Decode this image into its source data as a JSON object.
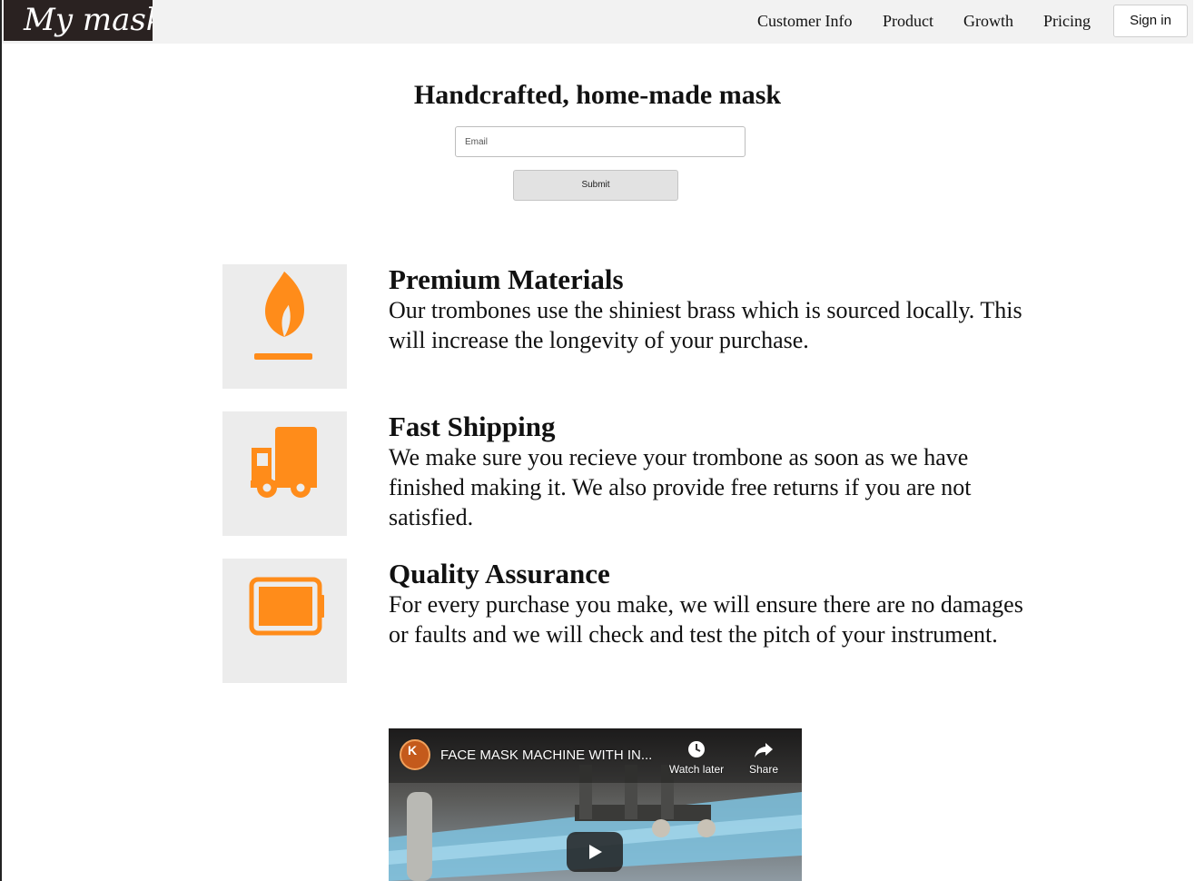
{
  "brand": {
    "logo_text": "My mask"
  },
  "nav": {
    "items": [
      {
        "label": "Customer Info"
      },
      {
        "label": "Product"
      },
      {
        "label": "Growth"
      },
      {
        "label": "Pricing"
      }
    ],
    "signin_label": "Sign in"
  },
  "hero": {
    "title": "Handcrafted, home-made mask",
    "email_placeholder": "Email",
    "submit_label": "Submit"
  },
  "features": [
    {
      "icon": "flame-icon",
      "title": "Premium Materials",
      "description": "Our trombones use the shiniest brass which is sourced locally. This will increase the longevity of your purchase."
    },
    {
      "icon": "truck-icon",
      "title": "Fast Shipping",
      "description": "We make sure you recieve your trombone as soon as we have finished making it. We also provide free returns if you are not satisfied."
    },
    {
      "icon": "battery-icon",
      "title": "Quality Assurance",
      "description": "For every purchase you make, we will ensure there are no damages or faults and we will check and test the pitch of your instrument."
    }
  ],
  "video": {
    "title": "FACE MASK MACHINE WITH IN...",
    "channel_initial": "K",
    "watch_later_label": "Watch later",
    "share_label": "Share"
  },
  "colors": {
    "accent": "#ff8c1a",
    "header_bg": "#f2f2f2",
    "logo_bg": "#2a2221",
    "icon_box_bg": "#ececec"
  }
}
